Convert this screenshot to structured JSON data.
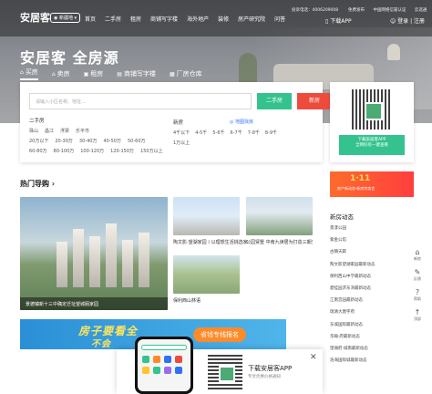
{
  "header": {
    "logo": "安居客",
    "city": "新疆地",
    "nav": [
      "首页",
      "二手房",
      "租房",
      "商铺写字楼",
      "海外地产",
      "装修",
      "房产研究院",
      "问答"
    ],
    "hotline": "投诉电话：4006209008",
    "top_links": [
      "免费发布",
      "中国网络信誉认证",
      "云选通"
    ],
    "download_app": "下载APP",
    "login": "登录 | 注册"
  },
  "hero": {
    "slogan": "安居客 全房源",
    "tabs": [
      {
        "icon": "⌂",
        "label": "买房"
      },
      {
        "icon": "⌂",
        "label": "卖房"
      },
      {
        "icon": "▣",
        "label": "租房"
      },
      {
        "icon": "▤",
        "label": "商铺写字楼"
      },
      {
        "icon": "▦",
        "label": "厂房仓库"
      }
    ]
  },
  "search": {
    "placeholder": "请输入小区名称、地址…",
    "btn_secondhand": "二手房",
    "btn_new": "新房"
  },
  "filters": {
    "secondhand_title": "二手房",
    "secondhand_regions": [
      "珠山",
      "昌江",
      "浮梁",
      "乐平市"
    ],
    "secondhand_prices_1": [
      "20万以下",
      "20-30万",
      "30-40万",
      "40-50万",
      "50-60万"
    ],
    "secondhand_prices_2": [
      "60-80万",
      "80-100万",
      "100-120万",
      "120-150万",
      "150万以上"
    ],
    "new_title": "新房",
    "map_link": "◎ 地图找房",
    "new_prices_1": [
      "4千以下",
      "4-5千",
      "5-6千",
      "6-7千",
      "7-8千",
      "8-9千"
    ],
    "new_prices_2": [
      "1万以上"
    ]
  },
  "qr_card": {
    "btn_line1": "下载安居客APP",
    "btn_line2": "全网好房一键查看"
  },
  "hot": {
    "title": "热门导购 ›",
    "big_caption": "景德镇新十三中确定迁址望城厢家园",
    "small": [
      {
        "caption": "陶文影·望湖家园丨以理想生活挑选家"
      },
      {
        "caption": "公园贤墅 中南九读居为打造三期交付"
      },
      {
        "caption": "保利西山林语"
      }
    ]
  },
  "banner": {
    "text": "房子要看全",
    "text2": "不会",
    "pill": "省钱专线报名"
  },
  "right": {
    "promo_big": "1·11",
    "promo_sub": "房产新动态·新房特卖会",
    "side_title": "新房动态",
    "items": [
      "新房动态",
      "景漾公园",
      "紫金公馆",
      "古镇天簌",
      "陶文影望湖家园最新动态",
      "保利西山中学最新动态",
      "碧桂园济东湾最新动态",
      "江南宫园最新动态",
      "瑞清大唐宇府",
      "东城国际最新动态",
      "华翰·府最新动态",
      "望湖府·城南最新动态",
      "浩海国际城最新动态"
    ]
  },
  "tools": [
    {
      "icon": "⌂",
      "label": "新房"
    },
    {
      "icon": "✎",
      "label": "反馈"
    },
    {
      "icon": "?",
      "label": "帮助"
    },
    {
      "icon": "↑",
      "label": "顶部"
    }
  ],
  "popup": {
    "title": "下载安居客APP",
    "subtitle": "专享优惠价格通知",
    "close": "✕"
  },
  "colors": {
    "green": "#34c38f",
    "red": "#ef4b3c",
    "blue_link": "#3072f6"
  }
}
